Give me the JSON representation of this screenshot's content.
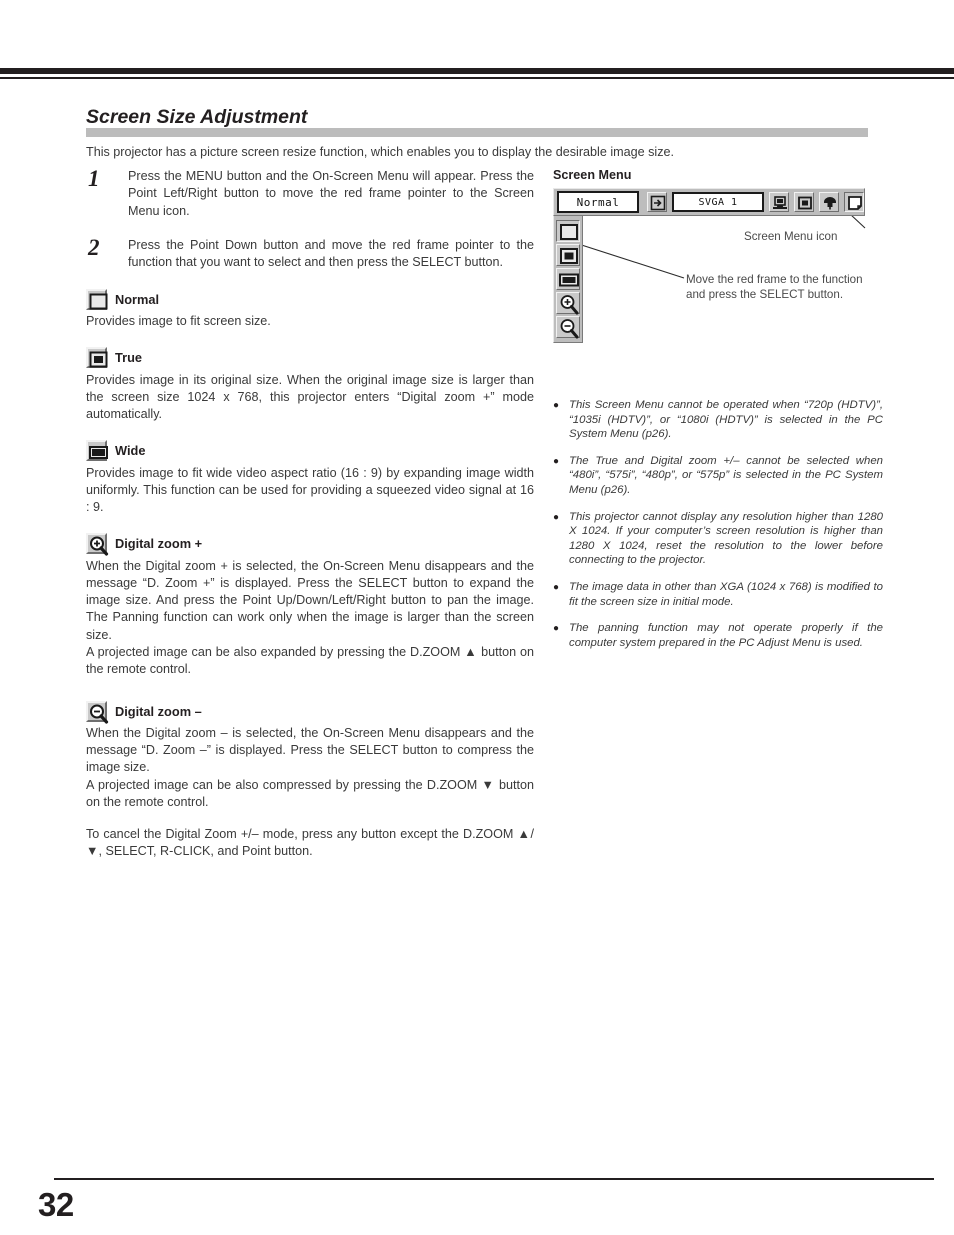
{
  "page": {
    "heading": "Screen Size Adjustment",
    "intro": "This projector has a picture screen resize function, which enables you to display the desirable image size.",
    "number": "32"
  },
  "steps": [
    {
      "num": "1",
      "text": "Press the MENU button and the On-Screen Menu will appear. Press the Point Left/Right button to move the red frame pointer to the Screen Menu icon."
    },
    {
      "num": "2",
      "text": "Press the Point Down button and move the red frame pointer to the function that you want to select and then press the SELECT button."
    }
  ],
  "functions": [
    {
      "icon": "normal-screen-icon",
      "title": "Normal",
      "paragraphs": [
        "Provides image to fit screen size."
      ]
    },
    {
      "icon": "true-screen-icon",
      "title": "True",
      "paragraphs": [
        "Provides image in its original size.  When the original image size is larger than the screen size 1024 x 768, this projector enters “Digital zoom +” mode automatically."
      ]
    },
    {
      "icon": "wide-screen-icon",
      "title": "Wide",
      "paragraphs": [
        "Provides image to fit wide video aspect ratio (16 : 9) by expanding image width uniformly.  This function can be used for providing a squeezed video signal at 16 : 9."
      ]
    },
    {
      "icon": "zoom-in-icon",
      "title": "Digital zoom +",
      "paragraphs": [
        "When the Digital zoom + is selected, the On-Screen Menu disappears and the message “D. Zoom +” is displayed.  Press the SELECT button to expand the image size.  And press the Point Up/Down/Left/Right button to pan the image.  The Panning function can work only when the image is larger than the screen size.",
        "A projected image can be also expanded by pressing the D.ZOOM ▲ button on the remote control."
      ]
    },
    {
      "icon": "zoom-out-icon",
      "title": "Digital zoom –",
      "paragraphs": [
        "When the Digital zoom – is selected, the On-Screen Menu disappears and the message “D. Zoom –” is displayed.  Press the SELECT button to compress the image size.",
        "A projected image can be also compressed by pressing the D.ZOOM ▼ button on the remote control."
      ]
    }
  ],
  "closing": "To cancel the Digital Zoom +/– mode, press any button except the D.ZOOM ▲/▼, SELECT, R-CLICK, and Point button.",
  "diagram": {
    "label": "Screen Menu",
    "mode_value": "Normal",
    "source_value": "SVGA 1",
    "menubar_icons": [
      "input-source-icon",
      "computer-icon",
      "screen-icon",
      "sound-icon",
      "screen-menu-icon"
    ],
    "sidebar_icons": [
      "normal-screen-icon",
      "true-screen-icon",
      "wide-screen-icon",
      "zoom-in-icon",
      "zoom-out-icon"
    ],
    "annotation_icon": "Screen Menu icon",
    "annotation_move": "Move the red frame to the function and press the SELECT button."
  },
  "notes": [
    "This Screen Menu cannot be operated when “720p (HDTV)”, “1035i (HDTV)”, or “1080i (HDTV)” is selected in the PC System Menu  (p26).",
    "The True and Digital zoom +/– cannot be selected when “480i”, “575i”, “480p”, or “575p” is selected in the PC System Menu  (p26).",
    "This projector cannot display any resolution higher than 1280 X 1024.  If your computer’s screen resolution is higher than 1280 X 1024, reset the resolution to the lower before connecting to the projector.",
    "The image data in other than XGA (1024 x 768) is modified to fit the screen size in initial mode.",
    "The panning function may not operate properly if the computer system prepared in the PC Adjust Menu is used."
  ],
  "bullet_glyph": "●"
}
